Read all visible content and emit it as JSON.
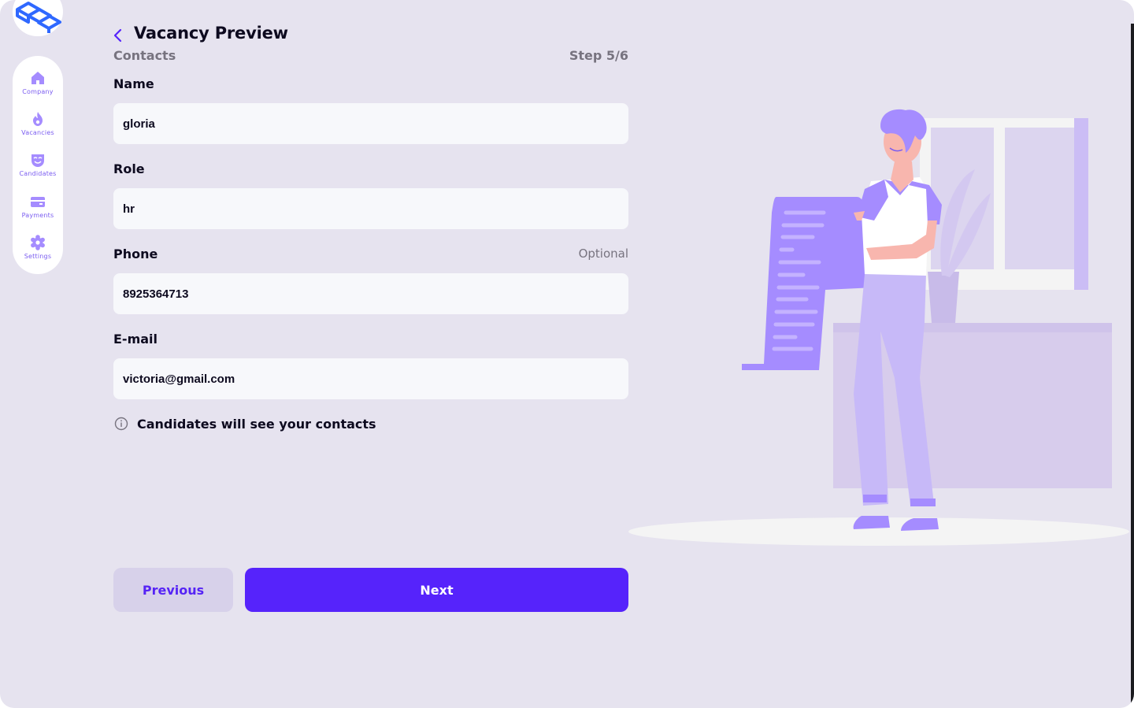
{
  "app": {
    "colors": {
      "background": "#e6e3ef",
      "accent": "#5623fb",
      "accent_soft": "#d7d1ea",
      "nav_icon": "#a58cff",
      "logo": "#2f68ff",
      "input_bg": "#f7f8fb"
    }
  },
  "sidebar": {
    "items": [
      {
        "label": "Company",
        "icon": "home-icon"
      },
      {
        "label": "Vacancies",
        "icon": "flame-icon"
      },
      {
        "label": "Candidates",
        "icon": "mask-icon"
      },
      {
        "label": "Payments",
        "icon": "credit-card-icon"
      },
      {
        "label": "Settings",
        "icon": "gear-icon"
      }
    ]
  },
  "header": {
    "title": "Vacancy Preview",
    "subtitle": "Contacts",
    "step": "Step 5/6"
  },
  "form": {
    "name": {
      "label": "Name",
      "value": "gloria"
    },
    "role": {
      "label": "Role",
      "value": "hr"
    },
    "phone": {
      "label": "Phone",
      "optional": "Optional",
      "value": "8925364713"
    },
    "email": {
      "label": "E-mail",
      "value": "victoria@gmail.com"
    },
    "info": "Candidates will see your contacts"
  },
  "buttons": {
    "previous": "Previous",
    "next": "Next"
  }
}
